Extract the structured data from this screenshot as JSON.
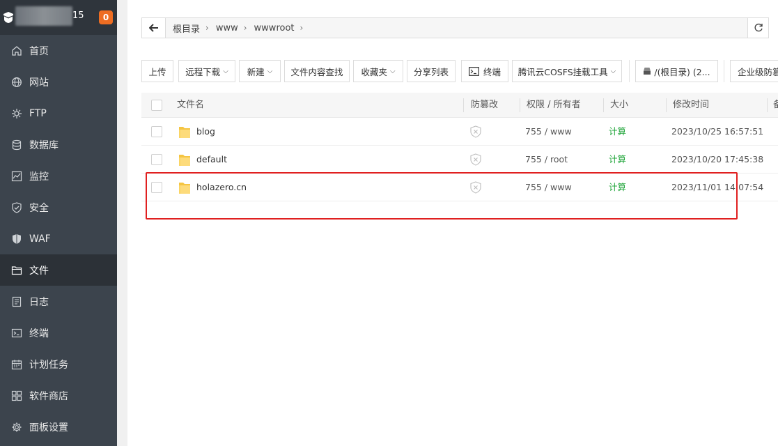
{
  "sidebar": {
    "user_suffix": "15",
    "badge": "0",
    "items": [
      {
        "label": "首页",
        "icon": "home-icon"
      },
      {
        "label": "网站",
        "icon": "globe-icon"
      },
      {
        "label": "FTP",
        "icon": "ftp-icon"
      },
      {
        "label": "数据库",
        "icon": "database-icon"
      },
      {
        "label": "监控",
        "icon": "monitor-icon"
      },
      {
        "label": "安全",
        "icon": "shield-check-icon"
      },
      {
        "label": "WAF",
        "icon": "waf-icon"
      },
      {
        "label": "文件",
        "icon": "folder-icon"
      },
      {
        "label": "日志",
        "icon": "log-icon"
      },
      {
        "label": "终端",
        "icon": "terminal-icon"
      },
      {
        "label": "计划任务",
        "icon": "calendar-icon"
      },
      {
        "label": "软件商店",
        "icon": "grid-icon"
      },
      {
        "label": "面板设置",
        "icon": "gear-icon"
      }
    ],
    "active_index": 7
  },
  "path": {
    "crumbs": [
      "根目录",
      "www",
      "wwwroot"
    ]
  },
  "toolbar": {
    "upload": "上传",
    "remote_download": "远程下载",
    "new": "新建",
    "content_search": "文件内容查找",
    "favorites": "收藏夹",
    "share_list": "分享列表",
    "terminal": "终端",
    "cosfs": "腾讯云COSFS挂载工具",
    "disk": "/(根目录) (2...",
    "enterprise": "企业级防篡"
  },
  "table": {
    "headers": {
      "name": "文件名",
      "tamper": "防篡改",
      "perm": "权限 / 所有者",
      "size": "大小",
      "mtime": "修改时间",
      "extra": "备"
    },
    "rows": [
      {
        "name": "blog",
        "perm": "755 / www",
        "size": "计算",
        "mtime": "2023/10/25 16:57:51"
      },
      {
        "name": "default",
        "perm": "755 / root",
        "size": "计算",
        "mtime": "2023/10/20 17:45:38"
      },
      {
        "name": "holazero.cn",
        "perm": "755 / www",
        "size": "计算",
        "mtime": "2023/11/01 14:07:54"
      }
    ]
  },
  "colors": {
    "sidebar_bg": "#3c444d",
    "sidebar_active": "#2c3137",
    "badge": "#ee6d22",
    "accent_green": "#20a53a",
    "highlight": "#e02020"
  }
}
